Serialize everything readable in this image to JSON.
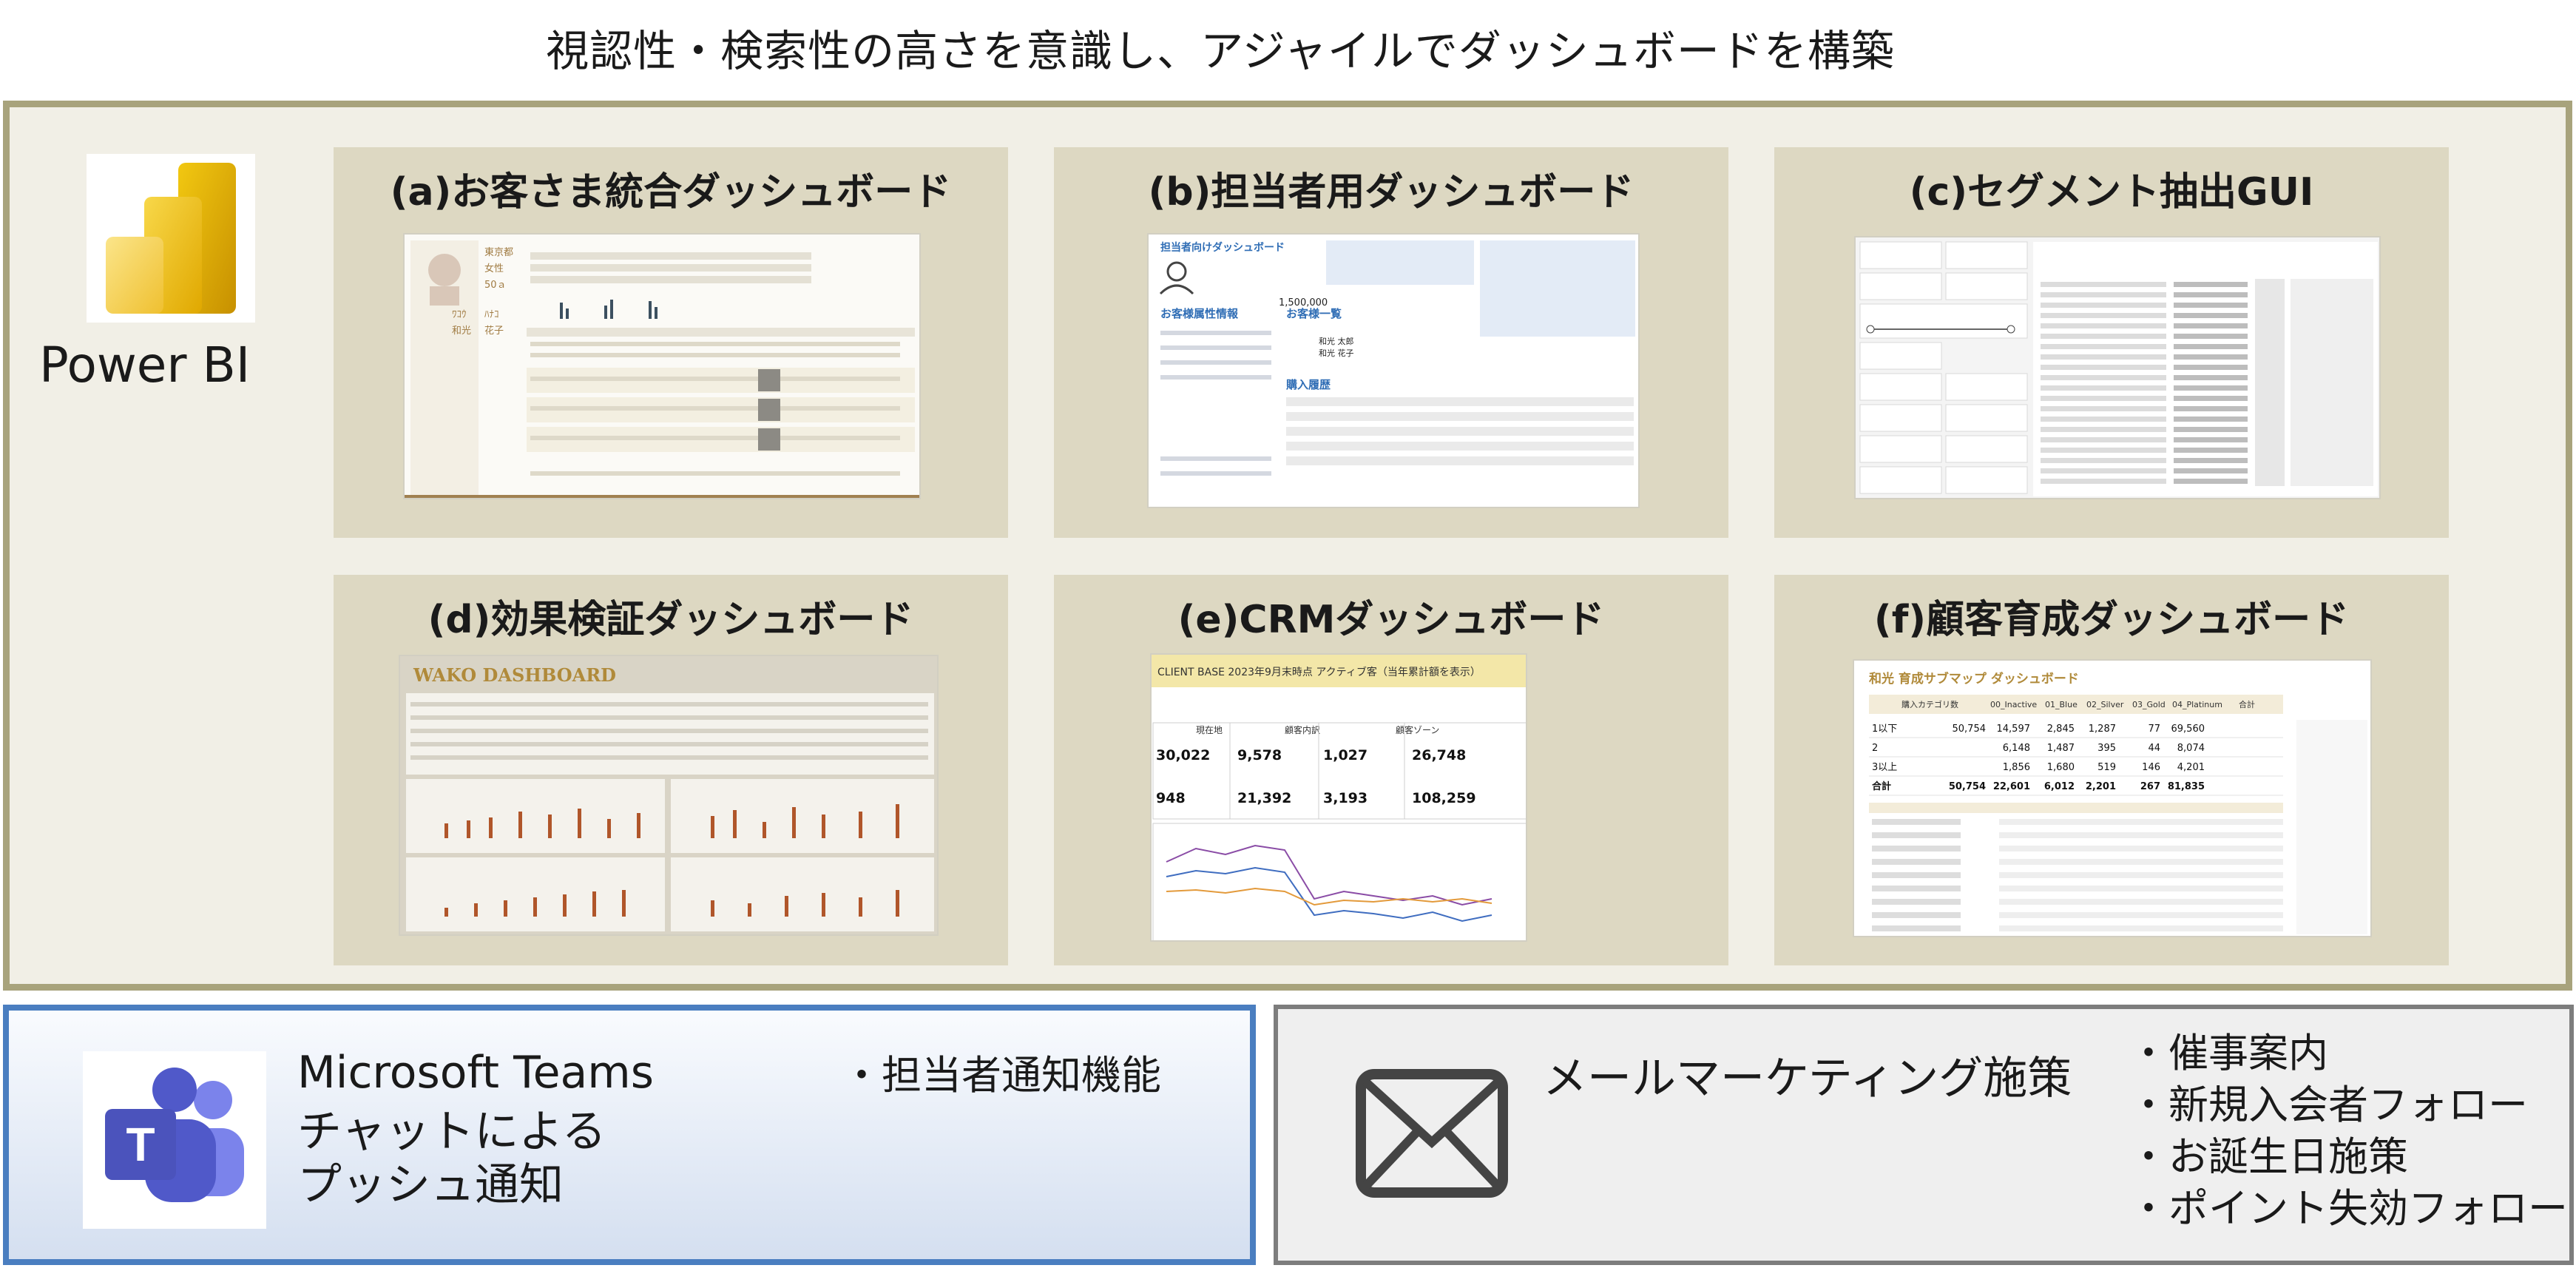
{
  "title": "視認性・検索性の高さを意識し、アジャイルでダッシュボードを構築",
  "powerbi": {
    "label": "Power BI",
    "logo_icon": "power-bi-logo-icon",
    "frame_color": "#a8a37c"
  },
  "panels": [
    {
      "title": "(a)お客さま統合ダッシュボード"
    },
    {
      "title": "(b)担当者用ダッシュボード"
    },
    {
      "title": "(c)セグメント抽出GUI"
    },
    {
      "title": "(d)効果検証ダッシュボード"
    },
    {
      "title": "(e)CRMダッシュボード"
    },
    {
      "title": "(f)顧客育成ダッシュボード"
    }
  ],
  "shots": {
    "a": {
      "name1": "東京都",
      "name2": "女性",
      "name3": "50ａ",
      "name4": "ﾜｺｳ",
      "name5": "ﾊﾅｺ",
      "name6": "和光",
      "name7": "花子"
    },
    "b": {
      "header": "担当者向けダッシュボード",
      "section1": "お客様属性情報",
      "section2": "お客様一覧",
      "section3": "購入履歴",
      "val1": "1,500,000",
      "name1": "和光 太郎",
      "name2": "和光 花子"
    },
    "d": {
      "header": "WAKO DASHBOARD"
    },
    "e": {
      "header": "CLIENT BASE 2023年9月末時点 アクティブ客（当年累計額を表示）",
      "col1": "現在地",
      "col2": "顧客内訳",
      "col3": "顧客ゾーン",
      "v1": "30,022",
      "v2": "9,578",
      "v3": "1,027",
      "v4": "26,748",
      "v5": "948",
      "v6": "21,392",
      "v7": "3,193",
      "v8": "108,259"
    },
    "f": {
      "header": "和光 育成サブマップ ダッシュボード",
      "head": [
        "購入カテゴリ数",
        "00_Inactive",
        "01_Blue",
        "02_Silver",
        "03_Gold",
        "04_Platinum",
        "合計"
      ],
      "rows": [
        [
          "1以下",
          "50,754",
          "14,597",
          "2,845",
          "1,287",
          "77",
          "69,560"
        ],
        [
          "2",
          "",
          "6,148",
          "1,487",
          "395",
          "44",
          "8,074"
        ],
        [
          "3以上",
          "",
          "1,856",
          "1,680",
          "519",
          "146",
          "4,201"
        ],
        [
          "合計",
          "50,754",
          "22,601",
          "6,012",
          "2,201",
          "267",
          "81,835"
        ]
      ]
    }
  },
  "teams": {
    "app_name": "Microsoft Teams",
    "line1": "チャットによる",
    "line2": "プッシュ通知",
    "bullet": "・担当者通知機能",
    "logo_icon": "microsoft-teams-logo-icon",
    "border_color": "#4a7ec0"
  },
  "mail": {
    "title": "メールマーケティング施策",
    "icon": "envelope-icon",
    "bullets": [
      "・催事案内",
      "・新規入会者フォロー",
      "・お誕生日施策",
      "・ポイント失効フォロー"
    ]
  }
}
